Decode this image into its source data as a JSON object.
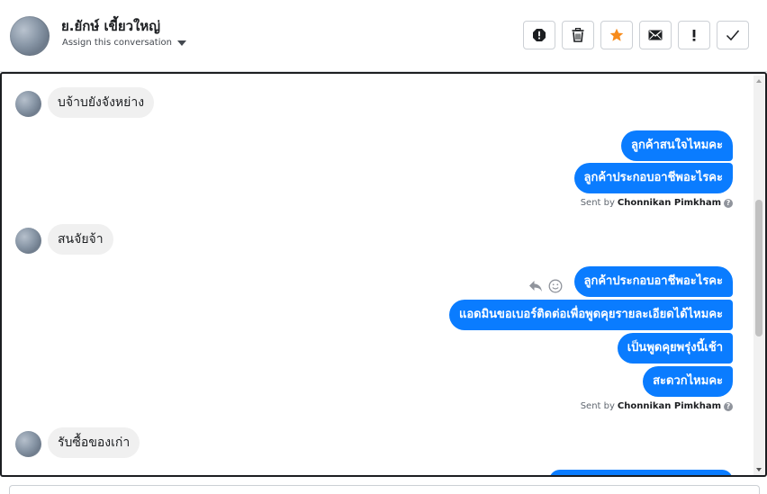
{
  "header": {
    "contact_name": "ย.ยักษ์ เขี้ยวใหญ่",
    "assign_label": "Assign this conversation"
  },
  "toolbar": {
    "buttons": [
      {
        "name": "spam",
        "icon": "octagon-alert-icon"
      },
      {
        "name": "delete",
        "icon": "trash-icon"
      },
      {
        "name": "star",
        "icon": "star-icon",
        "color": "#f78b1b"
      },
      {
        "name": "mark-unread",
        "icon": "envelope-icon"
      },
      {
        "name": "follow-up",
        "icon": "exclamation-icon"
      },
      {
        "name": "mark-done",
        "icon": "checkmark-icon"
      }
    ]
  },
  "messages": {
    "in_1": "บจ้าบยังจังหย่าง",
    "out_1": [
      "ลูกค้าสนใจไหมคะ",
      "ลูกค้าประกอบอาชีพอะไรคะ"
    ],
    "in_2": "สนจัยจ้า",
    "out_2": [
      "ลูกค้าประกอบอาชีพอะไรคะ",
      "แอดมินขอเบอร์ติดต่อเพื่อพูดคุยรายละเอียดได้ไหมคะ",
      "เป็นพูดคุยพรุ่งนี้เช้า",
      "สะดวกไหมคะ"
    ],
    "in_3": "รับซื้อของเก่า"
  },
  "sent_by": {
    "prefix": "Sent by",
    "agent": "Chonnikan Pimkham",
    "help": "?"
  },
  "colors": {
    "outgoing_bubble": "#0a7cff",
    "incoming_bubble": "#f0f0f0",
    "star_accent": "#f78b1b"
  }
}
